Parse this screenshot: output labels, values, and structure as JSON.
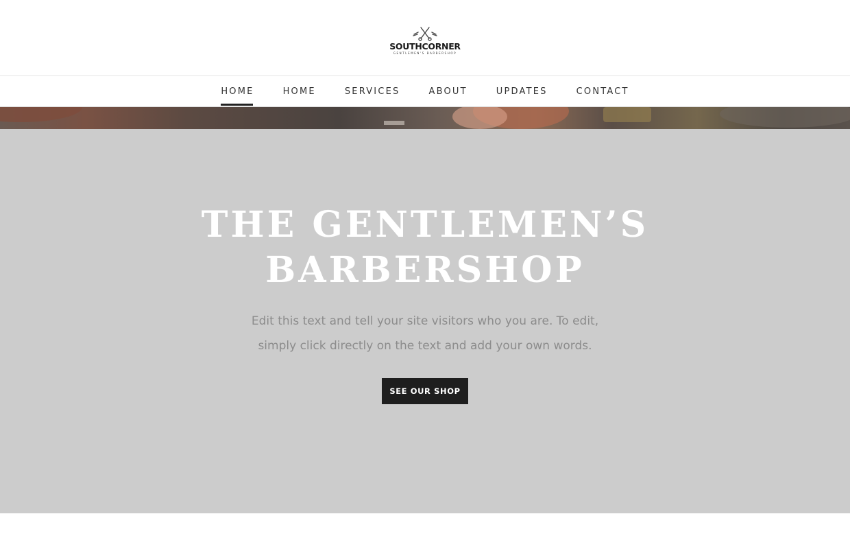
{
  "header": {
    "logo_name": "SOUTHCORNER",
    "logo_tagline": "GENTLEMEN'S BARBERSHOP",
    "logo_icon": "crossed-razor-scissors-icon"
  },
  "nav": {
    "items": [
      {
        "label": "HOME",
        "active": true
      },
      {
        "label": "HOME",
        "active": false
      },
      {
        "label": "SERVICES",
        "active": false
      },
      {
        "label": "ABOUT",
        "active": false
      },
      {
        "label": "UPDATES",
        "active": false
      },
      {
        "label": "CONTACT",
        "active": false
      }
    ]
  },
  "hero": {
    "title_line1": "THE GENTLEMEN’S",
    "title_line2": "BARBERSHOP",
    "text_line1": "Edit this text and tell your site visitors who you are. To edit,",
    "text_line2": "simply click directly on the text and add your own words.",
    "cta_label": "SEE OUR SHOP"
  },
  "colors": {
    "hero_background": "#cccccc",
    "button_background": "#1e1e1e",
    "nav_text": "#333333",
    "hero_text": "#8c8c8c"
  }
}
